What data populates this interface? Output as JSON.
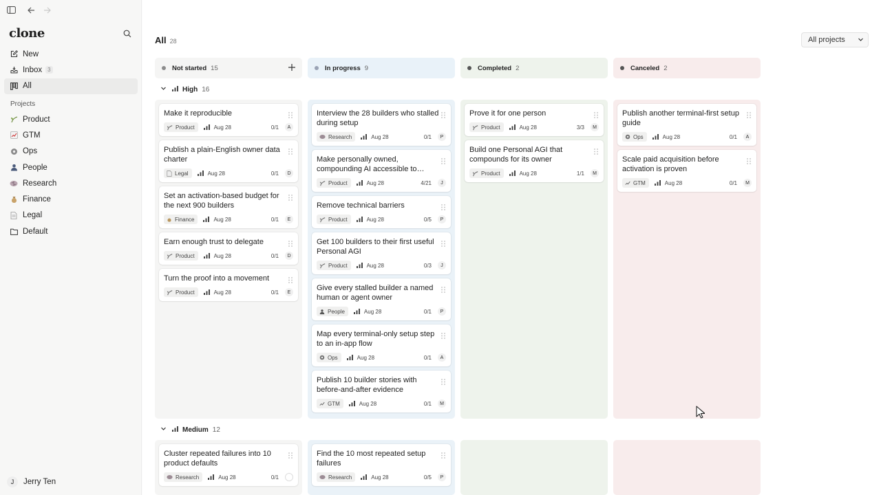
{
  "sidebar": {
    "logo": "clone",
    "nav": [
      {
        "label": "New",
        "icon": "compose-icon"
      },
      {
        "label": "Inbox",
        "icon": "inbox-icon",
        "badge": "3"
      },
      {
        "label": "All",
        "icon": "board-icon"
      }
    ],
    "projects_heading": "Projects",
    "projects": [
      {
        "label": "Product",
        "icon": "sprout-icon"
      },
      {
        "label": "GTM",
        "icon": "chart-up-icon"
      },
      {
        "label": "Ops",
        "icon": "gear-icon"
      },
      {
        "label": "People",
        "icon": "person-icon"
      },
      {
        "label": "Research",
        "icon": "brain-icon"
      },
      {
        "label": "Finance",
        "icon": "money-bag-icon"
      },
      {
        "label": "Legal",
        "icon": "document-icon"
      },
      {
        "label": "Default",
        "icon": "folder-icon"
      }
    ],
    "user": {
      "initial": "J",
      "name": "Jerry Ten"
    }
  },
  "main": {
    "title": "All",
    "title_count": "28",
    "project_filter": "All projects",
    "columns": [
      {
        "label": "Not started",
        "count": "15",
        "dot": "#8c8c8c",
        "bg": "#f5f5f4",
        "lane_bg": "#f5f5f4"
      },
      {
        "label": "In progress",
        "count": "9",
        "dot": "#9aa3b5",
        "bg": "#e9f2f9",
        "lane_bg": "#eaf2f8"
      },
      {
        "label": "Completed",
        "count": "2",
        "dot": "#555555",
        "bg": "#eef3ec",
        "lane_bg": "#eef3ec"
      },
      {
        "label": "Canceled",
        "count": "2",
        "dot": "#555555",
        "bg": "#f8ecec",
        "lane_bg": "#f8ecec"
      }
    ],
    "groups": [
      {
        "name": "High",
        "count": "16",
        "lanes": [
          [
            {
              "title": "Make it reproducible",
              "tag": "Product",
              "tag_icon": "sprout",
              "date": "Aug 28",
              "progress": "0/1",
              "avatar": "A"
            },
            {
              "title": "Publish a plain-English owner data charter",
              "tag": "Legal",
              "tag_icon": "doc",
              "date": "Aug 28",
              "progress": "0/1",
              "avatar": "D"
            },
            {
              "title": "Set an activation-based budget for the next 900 builders",
              "tag": "Finance",
              "tag_icon": "bag",
              "date": "Aug 28",
              "progress": "0/1",
              "avatar": "E"
            },
            {
              "title": "Earn enough trust to delegate",
              "tag": "Product",
              "tag_icon": "sprout",
              "date": "Aug 28",
              "progress": "0/1",
              "avatar": "D"
            },
            {
              "title": "Turn the proof into a movement",
              "tag": "Product",
              "tag_icon": "sprout",
              "date": "Aug 28",
              "progress": "0/1",
              "avatar": "E"
            }
          ],
          [
            {
              "title": "Interview the 28 builders who stalled during setup",
              "tag": "Research",
              "tag_icon": "brain",
              "date": "Aug 28",
              "progress": "0/1",
              "avatar": "P"
            },
            {
              "title": "Make personally owned, compounding AI accessible to…",
              "tag": "Product",
              "tag_icon": "sprout",
              "date": "Aug 28",
              "progress": "4/21",
              "avatar": "J"
            },
            {
              "title": "Remove technical barriers",
              "tag": "Product",
              "tag_icon": "sprout",
              "date": "Aug 28",
              "progress": "0/5",
              "avatar": "P"
            },
            {
              "title": "Get 100 builders to their first useful Personal AGI",
              "tag": "Product",
              "tag_icon": "sprout",
              "date": "Aug 28",
              "progress": "0/3",
              "avatar": "J"
            },
            {
              "title": "Give every stalled builder a named human or agent owner",
              "tag": "People",
              "tag_icon": "person",
              "date": "Aug 28",
              "progress": "0/1",
              "avatar": "P"
            },
            {
              "title": "Map every terminal-only setup step to an in-app flow",
              "tag": "Ops",
              "tag_icon": "gear",
              "date": "Aug 28",
              "progress": "0/1",
              "avatar": "A"
            },
            {
              "title": "Publish 10 builder stories with before-and-after evidence",
              "tag": "GTM",
              "tag_icon": "chart",
              "date": "Aug 28",
              "progress": "0/1",
              "avatar": "M"
            }
          ],
          [
            {
              "title": "Prove it for one person",
              "tag": "Product",
              "tag_icon": "sprout",
              "date": "Aug 28",
              "progress": "3/3",
              "avatar": "M"
            },
            {
              "title": "Build one Personal AGI that compounds for its owner",
              "tag": "Product",
              "tag_icon": "sprout",
              "date": "Aug 28",
              "progress": "1/1",
              "avatar": "M"
            }
          ],
          [
            {
              "title": "Publish another terminal-first setup guide",
              "tag": "Ops",
              "tag_icon": "gear",
              "date": "Aug 28",
              "progress": "0/1",
              "avatar": "A"
            },
            {
              "title": "Scale paid acquisition before activation is proven",
              "tag": "GTM",
              "tag_icon": "chart",
              "date": "Aug 28",
              "progress": "0/1",
              "avatar": "M"
            }
          ]
        ]
      },
      {
        "name": "Medium",
        "count": "12",
        "lanes": [
          [
            {
              "title": "Cluster repeated failures into 10 product defaults",
              "tag": "Research",
              "tag_icon": "brain",
              "date": "Aug 28",
              "progress": "0/1",
              "avatar": ""
            }
          ],
          [
            {
              "title": "Find the 10 most repeated setup failures",
              "tag": "Research",
              "tag_icon": "brain",
              "date": "Aug 28",
              "progress": "0/5",
              "avatar": "P"
            }
          ],
          [],
          []
        ]
      }
    ]
  }
}
